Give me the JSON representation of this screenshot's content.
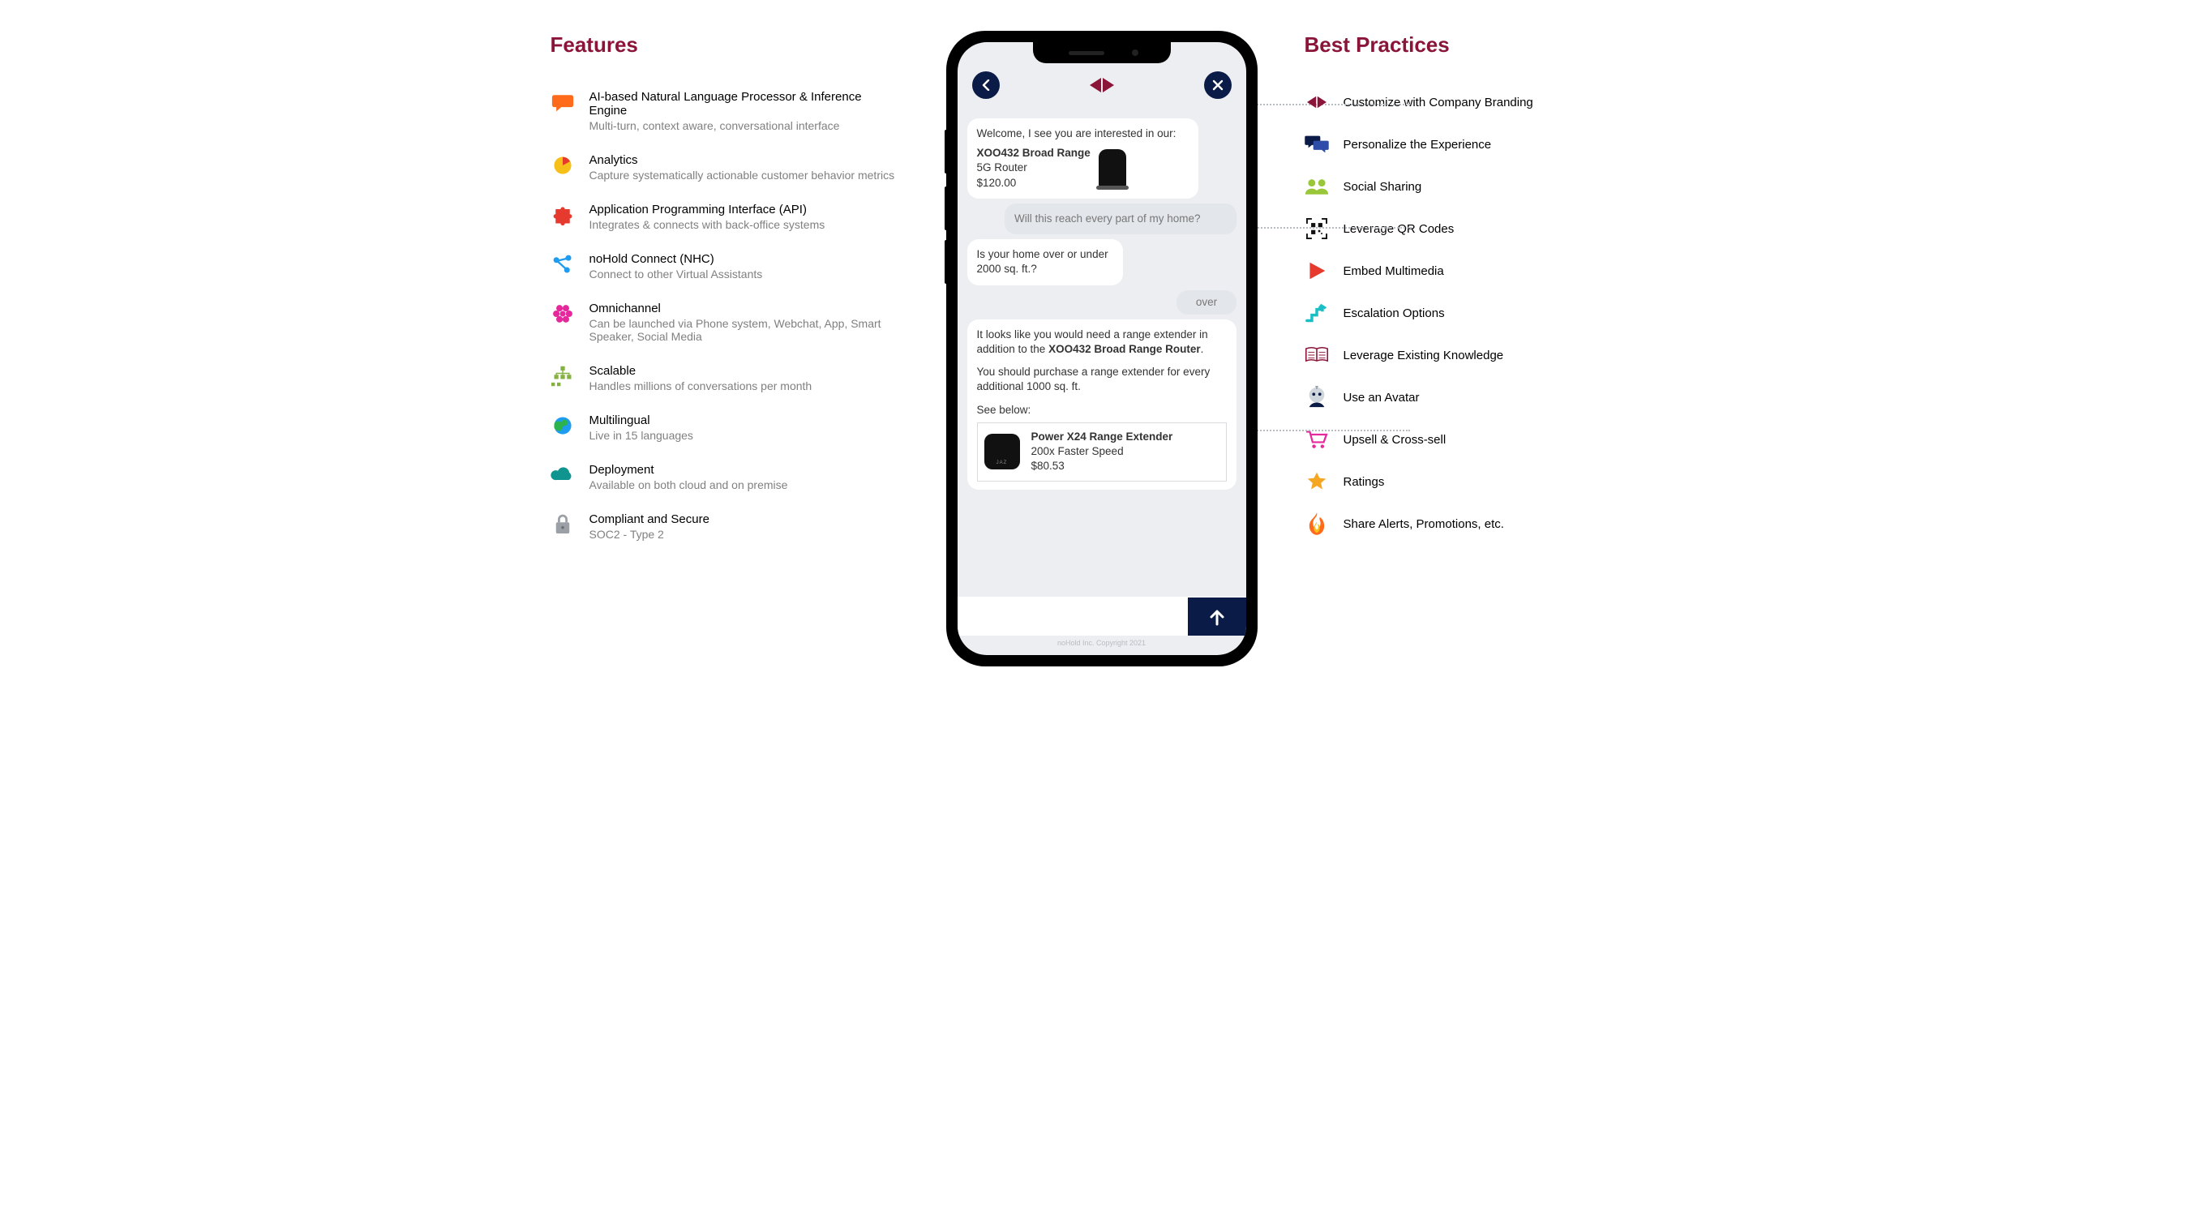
{
  "left": {
    "heading": "Features",
    "items": [
      {
        "icon": "chat-bubble",
        "title": "AI-based Natural Language Processor & Inference Engine",
        "sub": "Multi-turn, context aware, conversational interface"
      },
      {
        "icon": "pie-chart",
        "title": "Analytics",
        "sub": "Capture systematically actionable customer behavior metrics"
      },
      {
        "icon": "puzzle",
        "title": "Application Programming Interface (API)",
        "sub": "Integrates & connects with back-office systems"
      },
      {
        "icon": "nodes",
        "title": "noHold Connect (NHC)",
        "sub": "Connect to other Virtual Assistants"
      },
      {
        "icon": "flower",
        "title": "Omnichannel",
        "sub": "Can be launched via Phone system, Webchat, App, Smart Speaker, Social Media"
      },
      {
        "icon": "hierarchy",
        "title": "Scalable",
        "sub": "Handles millions of conversations per month"
      },
      {
        "icon": "globe",
        "title": "Multilingual",
        "sub": "Live in 15 languages"
      },
      {
        "icon": "cloud",
        "title": "Deployment",
        "sub": "Available on both cloud and on premise"
      },
      {
        "icon": "lock",
        "title": "Compliant and Secure",
        "sub": "SOC2 - Type 2"
      }
    ]
  },
  "right": {
    "heading": "Best Practices",
    "items": [
      {
        "icon": "bowtie",
        "label": "Customize with Company Branding"
      },
      {
        "icon": "chat-pair",
        "label": "Personalize the Experience"
      },
      {
        "icon": "people",
        "label": "Social Sharing"
      },
      {
        "icon": "qr",
        "label": "Leverage QR Codes"
      },
      {
        "icon": "play",
        "label": "Embed Multimedia"
      },
      {
        "icon": "stairs",
        "label": "Escalation Options"
      },
      {
        "icon": "book",
        "label": "Leverage Existing Knowledge"
      },
      {
        "icon": "avatar",
        "label": "Use an Avatar"
      },
      {
        "icon": "cart",
        "label": "Upsell & Cross-sell"
      },
      {
        "icon": "star",
        "label": "Ratings"
      },
      {
        "icon": "flame",
        "label": "Share Alerts, Promotions, etc."
      }
    ]
  },
  "phone": {
    "chat": {
      "welcome_prefix": "Welcome, I see you are interested in our:",
      "product": {
        "name": "XOO432 Broad Range",
        "type": "5G Router",
        "price": "$120.00"
      },
      "user_q1": "Will this reach every part of my home?",
      "bot_q": "Is your home over or under 2000 sq. ft.?",
      "user_a": "over",
      "rec_line1a": "It looks like you would need a range extender in addition to the ",
      "rec_line1b": "XOO432 Broad Range Router",
      "rec_line2": "You should purchase a range extender for every additional 1000 sq. ft.",
      "rec_see": "See below:",
      "rec_product": {
        "name": "Power X24 Range Extender",
        "sub": "200x Faster Speed",
        "price": "$80.53"
      }
    },
    "copyright": "noHold Inc. Copyright 2021"
  }
}
